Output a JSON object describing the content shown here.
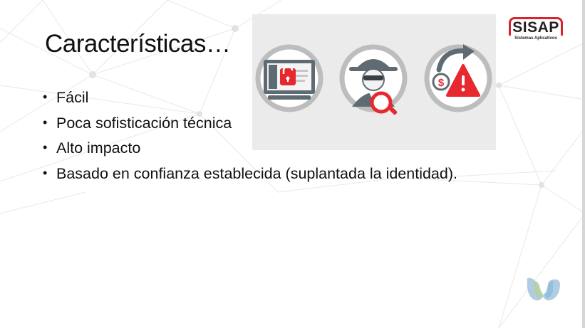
{
  "slide": {
    "title": "Características…",
    "bullets": [
      "Fácil",
      "Poca sofisticación técnica",
      "Alto impacto",
      "Basado en confianza establecida (suplantada la identidad)."
    ],
    "bullet_glyph": "•"
  },
  "logo": {
    "name": "SISAP",
    "tagline": "Sistemas Aplicativos",
    "brand_color": "#d9232e"
  },
  "icons": [
    "locked-computer-icon",
    "hacker-magnifier-icon",
    "money-warning-icon"
  ],
  "colors": {
    "icon_red": "#e8282f",
    "icon_gray": "#5f6b73",
    "panel_bg": "#ebebeb",
    "network_lines": "#e6e6e6",
    "webex_blue": "#8fbde0",
    "webex_green": "#b7cfa4"
  }
}
